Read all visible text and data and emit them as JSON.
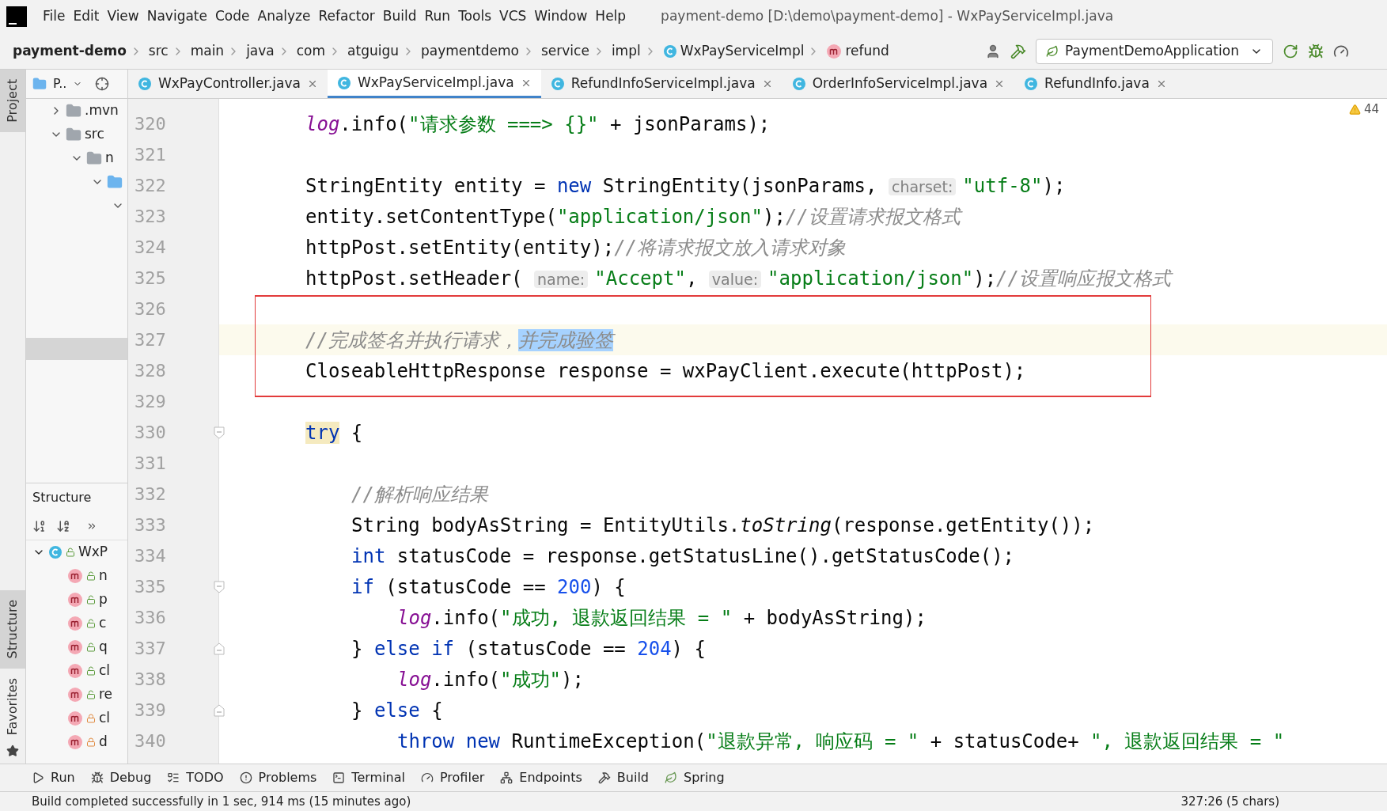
{
  "menu": [
    "File",
    "Edit",
    "View",
    "Navigate",
    "Code",
    "Analyze",
    "Refactor",
    "Build",
    "Run",
    "Tools",
    "VCS",
    "Window",
    "Help"
  ],
  "window": {
    "title": "payment-demo [D:\\demo\\payment-demo] - WxPayServiceImpl.java"
  },
  "breadcrumb": [
    {
      "label": "payment-demo",
      "kind": "project"
    },
    {
      "label": "src",
      "kind": "dir"
    },
    {
      "label": "main",
      "kind": "dir"
    },
    {
      "label": "java",
      "kind": "dir"
    },
    {
      "label": "com",
      "kind": "dir"
    },
    {
      "label": "atguigu",
      "kind": "dir"
    },
    {
      "label": "paymentdemo",
      "kind": "dir"
    },
    {
      "label": "service",
      "kind": "dir"
    },
    {
      "label": "impl",
      "kind": "dir"
    },
    {
      "label": "WxPayServiceImpl",
      "kind": "class"
    },
    {
      "label": "refund",
      "kind": "method"
    }
  ],
  "run_config": {
    "label": "PaymentDemoApplication"
  },
  "side_stripe": {
    "top": [
      {
        "label": "Project",
        "selected": true
      }
    ],
    "bottom": [
      {
        "label": "Structure",
        "selected": true
      },
      {
        "label": "Favorites",
        "selected": false
      }
    ]
  },
  "project_panel": {
    "title": "P..",
    "tree": [
      {
        "label": ".mvn",
        "kind": "folder",
        "expanded": false,
        "selected": false
      },
      {
        "label": "src",
        "kind": "folder",
        "expanded": true,
        "selected": false,
        "children": [
          {
            "label": "n",
            "kind": "folder",
            "expanded": true,
            "selected": false,
            "children": [
              {
                "kind": "package",
                "expanded": true,
                "selected": false,
                "children": [
                  {
                    "expanded": true,
                    "selected": false
                  }
                ]
              }
            ]
          }
        ]
      }
    ]
  },
  "structure_panel": {
    "title": "Structure",
    "root": {
      "label": "WxP",
      "expanded": true,
      "children": [
        {
          "label": "n",
          "locked": false
        },
        {
          "label": "p",
          "locked": false
        },
        {
          "label": "c",
          "locked": false
        },
        {
          "label": "q",
          "locked": false
        },
        {
          "label": "cl",
          "locked": false
        },
        {
          "label": "re",
          "locked": false
        },
        {
          "label": "cl",
          "locked": true
        },
        {
          "label": "d",
          "locked": true
        }
      ]
    }
  },
  "tabs": [
    {
      "label": "WxPayController.java",
      "selected": false
    },
    {
      "label": "WxPayServiceImpl.java",
      "selected": true
    },
    {
      "label": "RefundInfoServiceImpl.java",
      "selected": false
    },
    {
      "label": "OrderInfoServiceImpl.java",
      "selected": false
    },
    {
      "label": "RefundInfo.java",
      "selected": false
    }
  ],
  "inspections": {
    "warnings": "44"
  },
  "code": {
    "lines": [
      {
        "number": "320",
        "current": false,
        "boxed": false,
        "segments": [
          {
            "kind": "field",
            "text": "log"
          },
          {
            "kind": "plain",
            "text": ".info("
          },
          {
            "kind": "string",
            "text": "\"请求参数 ===> {}\""
          },
          {
            "kind": "plain",
            "text": " + jsonParams);"
          }
        ]
      },
      {
        "number": "321",
        "current": false,
        "boxed": false
      },
      {
        "number": "322",
        "current": false,
        "boxed": false,
        "segments": [
          {
            "kind": "plain",
            "text": "StringEntity entity = "
          },
          {
            "kind": "keyword",
            "text": "new"
          },
          {
            "kind": "plain",
            "text": " StringEntity(jsonParams, "
          },
          {
            "kind": "hint",
            "text": "charset:"
          },
          {
            "kind": "string",
            "text": "\"utf-8\""
          },
          {
            "kind": "plain",
            "text": ");"
          }
        ]
      },
      {
        "number": "323",
        "current": false,
        "boxed": false,
        "segments": [
          {
            "kind": "plain",
            "text": "entity.setContentType("
          },
          {
            "kind": "string",
            "text": "\"application/json\""
          },
          {
            "kind": "plain",
            "text": ");"
          },
          {
            "kind": "comment",
            "text": "//设置请求报文格式"
          }
        ]
      },
      {
        "number": "324",
        "current": false,
        "boxed": false,
        "segments": [
          {
            "kind": "plain",
            "text": "httpPost.setEntity(entity);"
          },
          {
            "kind": "comment",
            "text": "//将请求报文放入请求对象"
          }
        ]
      },
      {
        "number": "325",
        "current": false,
        "boxed": false,
        "segments": [
          {
            "kind": "plain",
            "text": "httpPost.setHeader( "
          },
          {
            "kind": "hint",
            "text": "name:"
          },
          {
            "kind": "string",
            "text": "\"Accept\""
          },
          {
            "kind": "plain",
            "text": ", "
          },
          {
            "kind": "hint",
            "text": "value:"
          },
          {
            "kind": "string",
            "text": "\"application/json\""
          },
          {
            "kind": "plain",
            "text": ");"
          },
          {
            "kind": "comment",
            "text": "//设置响应报文格式"
          }
        ]
      },
      {
        "number": "326",
        "current": false,
        "boxed": true
      },
      {
        "number": "327",
        "current": true,
        "boxed": true,
        "segments": [
          {
            "kind": "comment",
            "text": "//完成签名并执行请求，"
          },
          {
            "kind": "selection",
            "text": "并完成验签"
          }
        ]
      },
      {
        "number": "328",
        "current": false,
        "boxed": true,
        "segments": [
          {
            "kind": "plain",
            "text": "CloseableHttpResponse response = wxPayClient.execute(httpPost);"
          }
        ]
      },
      {
        "number": "329",
        "current": false,
        "boxed": false
      },
      {
        "number": "330",
        "current": false,
        "boxed": false,
        "kind": "block_start",
        "segments": [
          {
            "kind": "matched",
            "text": "try"
          },
          {
            "kind": "plain",
            "text": " {"
          }
        ],
        "children": [
          {
            "number": "331",
            "current": false,
            "boxed": false
          },
          {
            "number": "332",
            "current": false,
            "boxed": false,
            "segments": [
              {
                "kind": "comment",
                "text": "//解析响应结果"
              }
            ]
          },
          {
            "number": "333",
            "current": false,
            "boxed": false,
            "segments": [
              {
                "kind": "plain",
                "text": "String bodyAsString = EntityUtils."
              },
              {
                "kind": "static",
                "text": "toString"
              },
              {
                "kind": "plain",
                "text": "(response.getEntity());"
              }
            ]
          },
          {
            "number": "334",
            "current": false,
            "boxed": false,
            "segments": [
              {
                "kind": "keyword",
                "text": "int"
              },
              {
                "kind": "plain",
                "text": " statusCode = response.getStatusLine().getStatusCode();"
              }
            ]
          },
          {
            "number": "335",
            "current": false,
            "boxed": false,
            "kind": "block_start",
            "segments": [
              {
                "kind": "keyword",
                "text": "if"
              },
              {
                "kind": "plain",
                "text": " (statusCode == "
              },
              {
                "kind": "number",
                "text": "200"
              },
              {
                "kind": "plain",
                "text": ") {"
              }
            ],
            "children": [
              {
                "number": "336",
                "current": false,
                "boxed": false,
                "segments": [
                  {
                    "kind": "field",
                    "text": "log"
                  },
                  {
                    "kind": "plain",
                    "text": ".info("
                  },
                  {
                    "kind": "string",
                    "text": "\"成功, 退款返回结果 = \""
                  },
                  {
                    "kind": "plain",
                    "text": " + bodyAsString);"
                  }
                ]
              }
            ]
          },
          {
            "number": "337",
            "current": false,
            "boxed": false,
            "kind": "block_end",
            "segments": [
              {
                "kind": "plain",
                "text": "} "
              },
              {
                "kind": "keyword",
                "text": "else if"
              },
              {
                "kind": "plain",
                "text": " (statusCode == "
              },
              {
                "kind": "number",
                "text": "204"
              },
              {
                "kind": "plain",
                "text": ") {"
              }
            ],
            "children": [
              {
                "number": "338",
                "current": false,
                "boxed": false,
                "segments": [
                  {
                    "kind": "field",
                    "text": "log"
                  },
                  {
                    "kind": "plain",
                    "text": ".info("
                  },
                  {
                    "kind": "string",
                    "text": "\"成功\""
                  },
                  {
                    "kind": "plain",
                    "text": ");"
                  }
                ]
              }
            ]
          },
          {
            "number": "339",
            "current": false,
            "boxed": false,
            "kind": "block_end",
            "segments": [
              {
                "kind": "plain",
                "text": "} "
              },
              {
                "kind": "keyword",
                "text": "else"
              },
              {
                "kind": "plain",
                "text": " {"
              }
            ],
            "children": [
              {
                "number": "340",
                "current": false,
                "boxed": false,
                "segments": [
                  {
                    "kind": "keyword",
                    "text": "throw new"
                  },
                  {
                    "kind": "plain",
                    "text": " RuntimeException("
                  },
                  {
                    "kind": "string",
                    "text": "\"退款异常, 响应码 = \""
                  },
                  {
                    "kind": "plain",
                    "text": " + statusCode+ "
                  },
                  {
                    "kind": "string",
                    "text": "\", 退款返回结果 = \""
                  }
                ]
              }
            ]
          }
        ]
      }
    ]
  },
  "tool_bar": [
    {
      "label": "Run",
      "kind": "run"
    },
    {
      "label": "Debug",
      "kind": "debug"
    },
    {
      "label": "TODO",
      "kind": "todo"
    },
    {
      "label": "Problems",
      "kind": "problems"
    },
    {
      "label": "Terminal",
      "kind": "terminal"
    },
    {
      "label": "Profiler",
      "kind": "profiler"
    },
    {
      "label": "Endpoints",
      "kind": "endpoints"
    },
    {
      "label": "Build",
      "kind": "build"
    },
    {
      "label": "Spring",
      "kind": "spring"
    }
  ],
  "status_bar": {
    "message": "Build completed successfully in 1 sec, 914 ms (15 minutes ago)",
    "position": "327:26 (5 chars)"
  }
}
